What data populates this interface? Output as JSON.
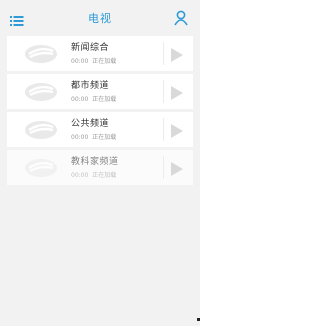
{
  "header": {
    "title": "电视",
    "menu_icon": "list-menu-icon",
    "user_icon": "user-icon"
  },
  "channels": [
    {
      "name": "新闻综合",
      "time": "00:00",
      "status": "正在加载"
    },
    {
      "name": "都市频道",
      "time": "00:00",
      "status": "正在加载"
    },
    {
      "name": "公共频道",
      "time": "00:00",
      "status": "正在加载"
    },
    {
      "name": "教科家频道",
      "time": "00:00",
      "status": "正在加载"
    }
  ],
  "colors": {
    "accent": "#2e9bd6",
    "background": "#f2f2f2",
    "row": "#ffffff",
    "play": "#d9d9d9"
  }
}
